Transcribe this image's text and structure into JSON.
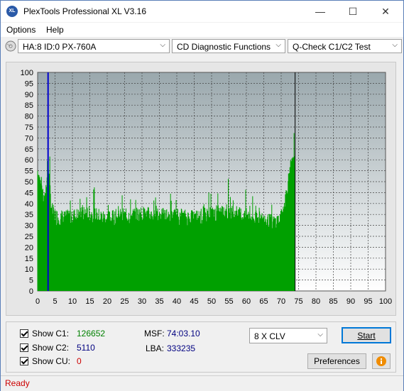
{
  "window": {
    "title": "PlexTools Professional XL V3.16",
    "icon": "XL",
    "controls": {
      "minimize": "—",
      "maximize": "☐",
      "close": "✕"
    }
  },
  "menu": {
    "options": "Options",
    "help": "Help"
  },
  "toolbar": {
    "drive": "HA:8 ID:0  PX-760A",
    "function": "CD Diagnostic Functions",
    "test": "Q-Check C1/C2 Test"
  },
  "chart_data": {
    "type": "bar",
    "x_ticks": [
      "0",
      "5",
      "10",
      "15",
      "20",
      "25",
      "30",
      "35",
      "40",
      "45",
      "50",
      "55",
      "60",
      "65",
      "70",
      "75",
      "80",
      "85",
      "90",
      "95",
      "100"
    ],
    "y_ticks": [
      "0",
      "5",
      "10",
      "15",
      "20",
      "25",
      "30",
      "35",
      "40",
      "45",
      "50",
      "55",
      "60",
      "65",
      "70",
      "75",
      "80",
      "85",
      "90",
      "95",
      "100"
    ],
    "xlim": [
      0,
      100
    ],
    "ylim": [
      0,
      100
    ],
    "grid": true,
    "series_color": "#00a000",
    "marker_color": "#0000cc",
    "end_line_color": "#000000",
    "blue_marker_x": 3,
    "end_x": 74,
    "profile": [
      [
        0,
        55
      ],
      [
        1,
        48
      ],
      [
        2,
        40
      ],
      [
        3,
        58
      ],
      [
        4,
        37
      ],
      [
        5,
        34
      ],
      [
        8,
        33
      ],
      [
        10,
        34
      ],
      [
        15,
        35
      ],
      [
        20,
        33
      ],
      [
        25,
        34
      ],
      [
        30,
        35
      ],
      [
        35,
        34
      ],
      [
        40,
        34
      ],
      [
        45,
        33
      ],
      [
        50,
        35
      ],
      [
        55,
        36
      ],
      [
        60,
        34
      ],
      [
        65,
        32
      ],
      [
        68,
        31
      ],
      [
        70,
        33
      ],
      [
        71,
        40
      ],
      [
        72,
        50
      ],
      [
        73,
        57
      ],
      [
        74,
        60
      ]
    ]
  },
  "stats": {
    "c1_label": "Show C1:",
    "c1_value": "126652",
    "c1_color": "#008000",
    "c2_label": "Show C2:",
    "c2_value": "5110",
    "c2_color": "#000080",
    "cu_label": "Show CU:",
    "cu_value": "0",
    "cu_color": "#cc0000"
  },
  "position": {
    "msf_label": "MSF:",
    "msf_value": "74:03.10",
    "lba_label": "LBA:",
    "lba_value": "333235"
  },
  "speed": {
    "selected": "8 X CLV"
  },
  "buttons": {
    "start": "Start",
    "preferences": "Preferences"
  },
  "status": {
    "text": "Ready"
  }
}
